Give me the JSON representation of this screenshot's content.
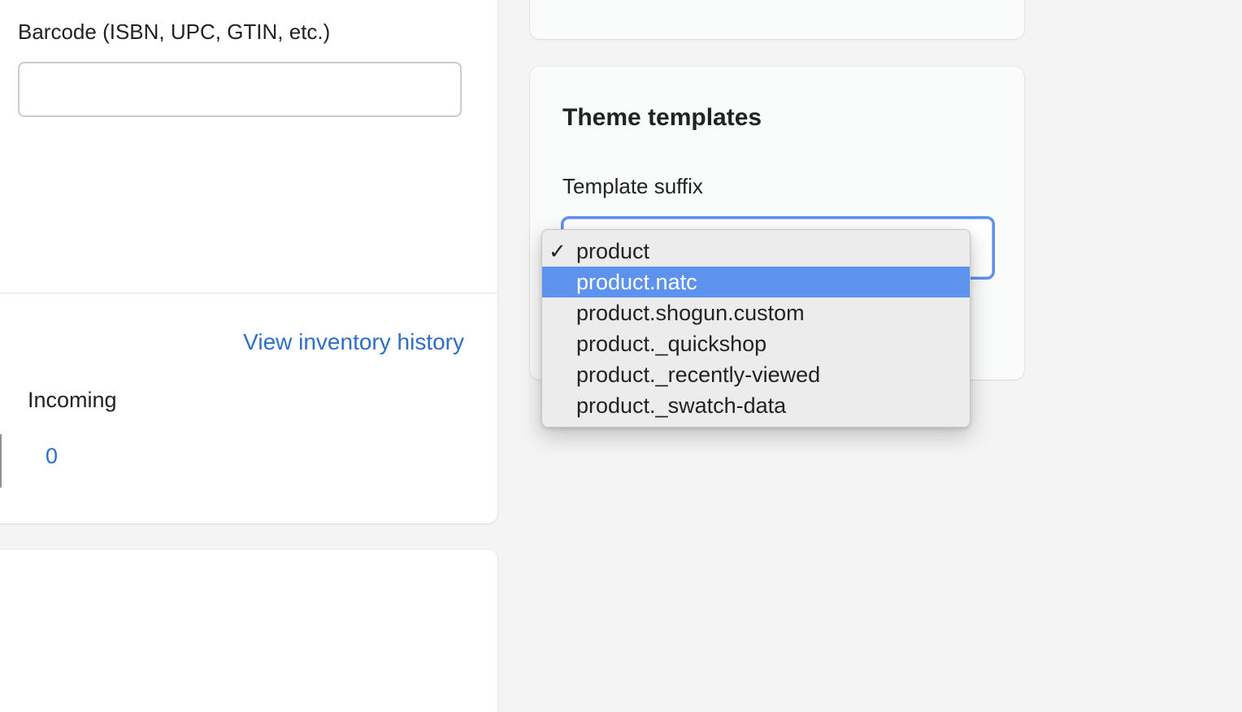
{
  "left_panel": {
    "barcode_label": "Barcode (ISBN, UPC, GTIN, etc.)",
    "barcode_value": "",
    "inventory_history_link": "View inventory history",
    "incoming_label": "Incoming",
    "incoming_value": "0"
  },
  "theme_templates": {
    "title": "Theme templates",
    "suffix_label": "Template suffix",
    "options": [
      {
        "label": "product",
        "checked": "✓"
      },
      {
        "label": "product.natc",
        "checked": ""
      },
      {
        "label": "product.shogun.custom",
        "checked": ""
      },
      {
        "label": "product._quickshop",
        "checked": ""
      },
      {
        "label": "product._recently-viewed",
        "checked": ""
      },
      {
        "label": "product._swatch-data",
        "checked": ""
      }
    ],
    "selected_option": "product",
    "highlighted_option": "product.natc"
  },
  "colors": {
    "link": "#2c6ecb",
    "focus_ring": "#5b8ff0",
    "menu_highlight": "#5d93ee",
    "page_background": "#f4f4f4"
  }
}
